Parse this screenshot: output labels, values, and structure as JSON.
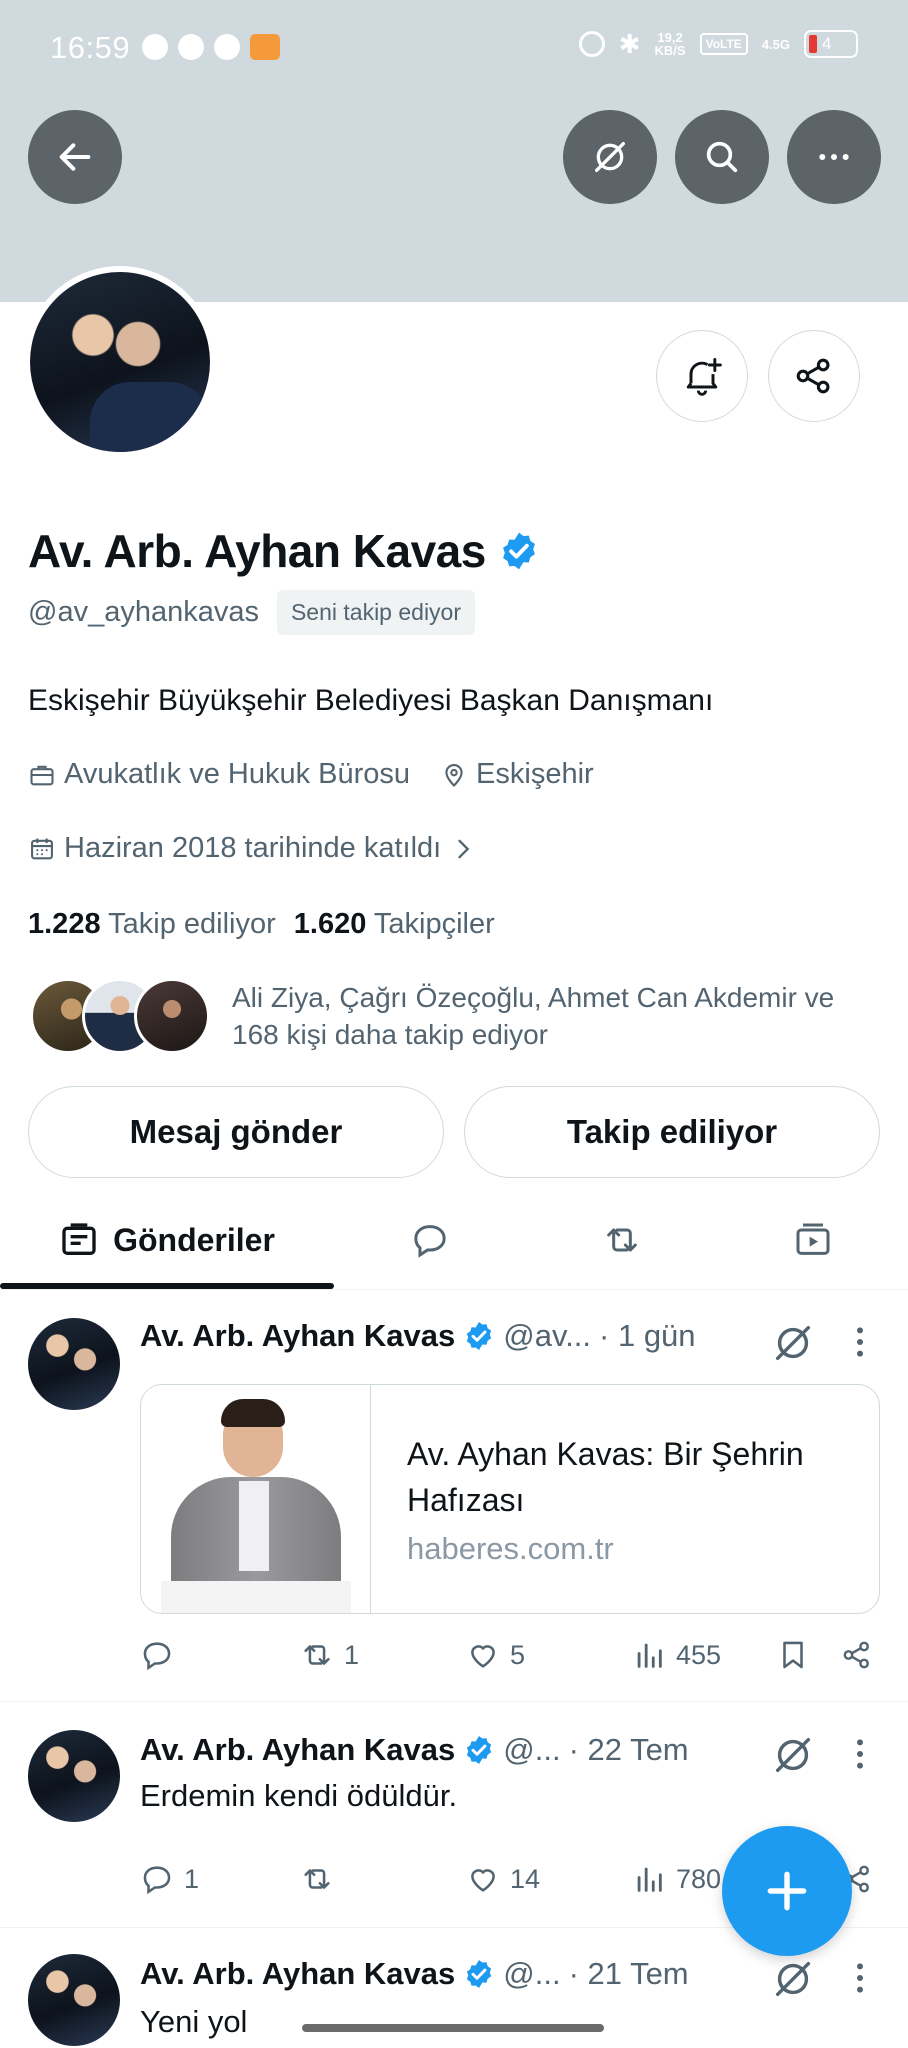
{
  "status_bar": {
    "time": "16:59",
    "speed_top": "19,2",
    "speed_bottom": "KB/S",
    "volte": "VoLTE",
    "network": "4.5G",
    "battery": "4"
  },
  "profile": {
    "name": "Av. Arb. Ayhan Kavas",
    "handle": "@av_ayhankavas",
    "follows_you": "Seni takip ediyor",
    "bio": "Eskişehir Büyükşehir Belediyesi Başkan Danışmanı",
    "category": "Avukatlık ve Hukuk Bürosu",
    "location": "Eskişehir",
    "joined": "Haziran 2018 tarihinde katıldı",
    "following_count": "1.228",
    "following_label": "Takip ediliyor",
    "followers_count": "1.620",
    "followers_label": "Takipçiler",
    "known_followers_line1": "Ali Ziya, Çağrı Özeçoğlu, Ahmet Can Akdemir ve",
    "known_followers_line2": "168 kişi daha takip ediyor",
    "message_button": "Mesaj gönder",
    "following_button": "Takip ediliyor"
  },
  "tabs": {
    "posts_label": "Gönderiler"
  },
  "posts": [
    {
      "name": "Av. Arb. Ayhan Kavas",
      "handle": "@av...",
      "time": "· 1 gün",
      "card_title_line1": "Av. Ayhan Kavas: Bir Şehrin",
      "card_title_line2": "Hafızası",
      "card_domain": "haberes.com.tr",
      "replies": "",
      "reposts": "1",
      "likes": "5",
      "views": "455"
    },
    {
      "name": "Av. Arb. Ayhan Kavas",
      "handle": "@...",
      "time": "· 22 Tem",
      "text": "Erdemin kendi ödüldür.",
      "replies": "1",
      "reposts": "",
      "likes": "14",
      "views": "780"
    },
    {
      "name": "Av. Arb. Ayhan Kavas",
      "handle": "@...",
      "time": "· 21 Tem",
      "text": "Yeni yol"
    }
  ],
  "colors": {
    "accent": "#1d9bf0",
    "banner": "#cfd9de",
    "text_secondary": "#536471"
  }
}
